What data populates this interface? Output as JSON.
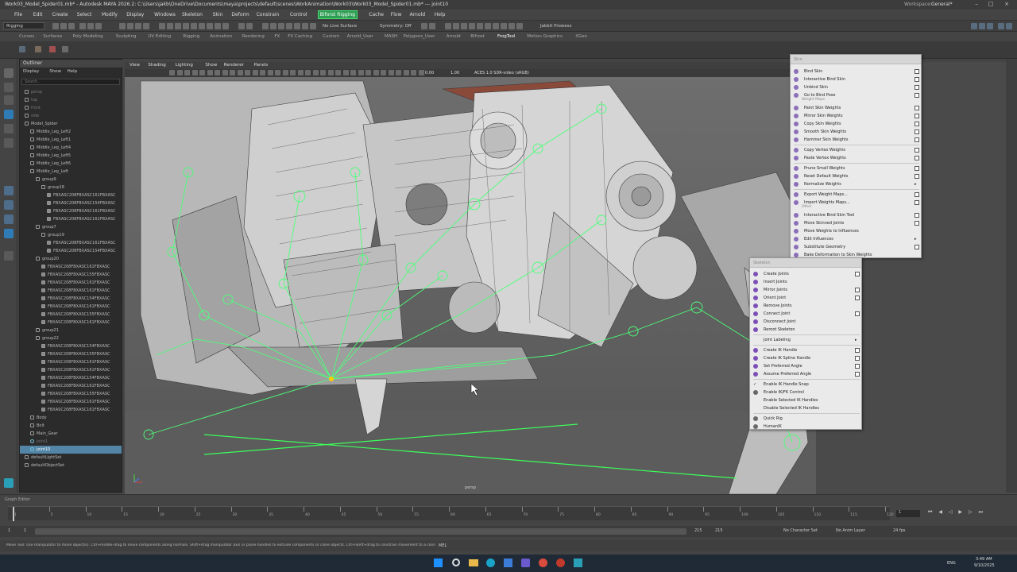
{
  "window": {
    "title": "Work03_Model_Spider01.mb* - Autodesk MAYA 2026.2: C:\\Users\\jakb\\OneDrive\\Documents\\maya\\projects\\default\\scenes\\WorkAnimation\\Work03\\Work03_Model_Spider01.mb* --- joint10",
    "workspace_label": "Workspace:",
    "workspace_value": "General*"
  },
  "menubar": [
    {
      "label": "File"
    },
    {
      "label": "Edit"
    },
    {
      "label": "Create"
    },
    {
      "label": "Select"
    },
    {
      "label": "Modify"
    },
    {
      "label": "Display"
    },
    {
      "label": "Windows"
    },
    {
      "label": "Skeleton"
    },
    {
      "label": "Skin"
    },
    {
      "label": "Deform"
    },
    {
      "label": "Constrain"
    },
    {
      "label": "Control"
    },
    {
      "label": "Biforst Rigging"
    },
    {
      "label": "Cache"
    },
    {
      "label": "Flow"
    },
    {
      "label": "Arnold"
    },
    {
      "label": "Help"
    }
  ],
  "status": {
    "menuset": "Rigging",
    "live_surface": "No Live Surface",
    "symmetry": "Symmetry: Off",
    "user": "Jakbit Prowess"
  },
  "shelf_tabs": [
    "Curves",
    "Surfaces",
    "Poly Modeling",
    "Sculpting",
    "UV Editing",
    "Rigging",
    "Animation",
    "Rendering",
    "FX",
    "FX Caching",
    "Custom",
    "Arnold_User",
    "MASH",
    "Polygons_User",
    "Arnold",
    "Bifrost",
    "FrogTool",
    "Motion Graphics",
    "XGen"
  ],
  "active_shelf": "FrogTool",
  "outliner": {
    "title": "Outliner",
    "menu": [
      "Display",
      "Show",
      "Help"
    ],
    "search_placeholder": "Search...",
    "rows": [
      {
        "label": "persp",
        "indent": 0,
        "kind": "cam",
        "dim": true
      },
      {
        "label": "top",
        "indent": 0,
        "kind": "cam",
        "dim": true
      },
      {
        "label": "front",
        "indent": 0,
        "kind": "cam",
        "dim": true
      },
      {
        "label": "side",
        "indent": 0,
        "kind": "cam",
        "dim": true
      },
      {
        "label": "Model_Spider",
        "indent": 0,
        "kind": "group"
      },
      {
        "label": "Middle_Leg_Left2",
        "indent": 1,
        "kind": "group"
      },
      {
        "label": "Middle_Leg_Left1",
        "indent": 1,
        "kind": "group"
      },
      {
        "label": "Middle_Leg_Left4",
        "indent": 1,
        "kind": "group"
      },
      {
        "label": "Middle_Leg_Left5",
        "indent": 1,
        "kind": "group"
      },
      {
        "label": "Middle_Leg_Left6",
        "indent": 1,
        "kind": "group"
      },
      {
        "label": "Middle_Leg_Left",
        "indent": 1,
        "kind": "group"
      },
      {
        "label": "group9",
        "indent": 2,
        "kind": "group"
      },
      {
        "label": "group18",
        "indent": 3,
        "kind": "group"
      },
      {
        "label": "FBXASC208FBXASC161FBXASC",
        "indent": 4,
        "kind": "mesh"
      },
      {
        "label": "FBXASC208FBXASC154FBXASC",
        "indent": 4,
        "kind": "mesh"
      },
      {
        "label": "FBXASC208FBXASC161FBXASC",
        "indent": 4,
        "kind": "mesh"
      },
      {
        "label": "FBXASC208FBXASC161FBXASC",
        "indent": 4,
        "kind": "mesh"
      },
      {
        "label": "group7",
        "indent": 2,
        "kind": "group"
      },
      {
        "label": "group19",
        "indent": 3,
        "kind": "group"
      },
      {
        "label": "FBXASC208FBXASC161FBXASC",
        "indent": 4,
        "kind": "mesh"
      },
      {
        "label": "FBXASC208FBXASC154FBXASC",
        "indent": 4,
        "kind": "mesh"
      },
      {
        "label": "group20",
        "indent": 2,
        "kind": "group"
      },
      {
        "label": "FBXASC208FBXASC161FBXASC",
        "indent": 3,
        "kind": "mesh"
      },
      {
        "label": "FBXASC208FBXASC155FBXASC",
        "indent": 3,
        "kind": "mesh"
      },
      {
        "label": "FBXASC208FBXASC161FBXASC",
        "indent": 3,
        "kind": "mesh"
      },
      {
        "label": "FBXASC208FBXASC161FBXASC",
        "indent": 3,
        "kind": "mesh"
      },
      {
        "label": "FBXASC208FBXASC154FBXASC",
        "indent": 3,
        "kind": "mesh"
      },
      {
        "label": "FBXASC208FBXASC161FBXASC",
        "indent": 3,
        "kind": "mesh"
      },
      {
        "label": "FBXASC208FBXASC155FBXASC",
        "indent": 3,
        "kind": "mesh"
      },
      {
        "label": "FBXASC208FBXASC161FBXASC",
        "indent": 3,
        "kind": "mesh"
      },
      {
        "label": "group21",
        "indent": 2,
        "kind": "group"
      },
      {
        "label": "group22",
        "indent": 2,
        "kind": "group"
      },
      {
        "label": "FBXASC208FBXASC154FBXASC",
        "indent": 3,
        "kind": "mesh"
      },
      {
        "label": "FBXASC208FBXASC155FBXASC",
        "indent": 3,
        "kind": "mesh"
      },
      {
        "label": "FBXASC208FBXASC161FBXASC",
        "indent": 3,
        "kind": "mesh"
      },
      {
        "label": "FBXASC208FBXASC161FBXASC",
        "indent": 3,
        "kind": "mesh"
      },
      {
        "label": "FBXASC208FBXASC154FBXASC",
        "indent": 3,
        "kind": "mesh"
      },
      {
        "label": "FBXASC208FBXASC161FBXASC",
        "indent": 3,
        "kind": "mesh"
      },
      {
        "label": "FBXASC208FBXASC155FBXASC",
        "indent": 3,
        "kind": "mesh"
      },
      {
        "label": "FBXASC208FBXASC161FBXASC",
        "indent": 3,
        "kind": "mesh"
      },
      {
        "label": "FBXASC208FBXASC161FBXASC",
        "indent": 3,
        "kind": "mesh"
      },
      {
        "label": "Body",
        "indent": 1,
        "kind": "group"
      },
      {
        "label": "Bolt",
        "indent": 1,
        "kind": "group"
      },
      {
        "label": "Main_Gear",
        "indent": 1,
        "kind": "group"
      },
      {
        "label": "joint1",
        "indent": 1,
        "kind": "joint",
        "dim": true
      },
      {
        "label": "joint10",
        "indent": 1,
        "kind": "joint",
        "selected": true
      },
      {
        "label": "defaultLightSet",
        "indent": 0,
        "kind": "set"
      },
      {
        "label": "defaultObjectSet",
        "indent": 0,
        "kind": "set"
      }
    ]
  },
  "viewport": {
    "menu": [
      "View",
      "Shading",
      "Lighting",
      "Show",
      "Renderer",
      "Panels"
    ],
    "exposure": "0.00",
    "gamma": "1.00",
    "color_space": "ACES 1.0 SDR-video (sRGB)",
    "camera_label": "persp"
  },
  "skin_menu": {
    "title": "Skin",
    "sections": [
      {
        "header": "",
        "items": [
          {
            "label": "Bind Skin",
            "box": true
          },
          {
            "label": "Interactive Bind Skin",
            "box": true
          },
          {
            "label": "Unbind Skin",
            "box": true
          },
          {
            "label": "Go to Bind Pose",
            "box": true
          }
        ]
      },
      {
        "header": "Weight Maps",
        "items": [
          {
            "label": "Paint Skin Weights",
            "box": true
          },
          {
            "label": "Mirror Skin Weights",
            "box": true
          },
          {
            "label": "Copy Skin Weights",
            "box": true
          },
          {
            "label": "Smooth Skin Weights",
            "box": true
          },
          {
            "label": "Hammer Skin Weights",
            "box": true
          }
        ]
      },
      {
        "header": "",
        "items": [
          {
            "label": "Copy Vertex Weights",
            "box": true
          },
          {
            "label": "Paste Vertex Weights",
            "box": true
          }
        ]
      },
      {
        "header": "",
        "items": [
          {
            "label": "Prune Small Weights",
            "box": true
          },
          {
            "label": "Reset Default Weights",
            "box": true
          },
          {
            "label": "Normalize Weights",
            "arrow": true
          }
        ]
      },
      {
        "header": "",
        "items": [
          {
            "label": "Export Weight Maps...",
            "box": true
          },
          {
            "label": "Import Weights Maps...",
            "box": true
          }
        ]
      },
      {
        "header": "Other",
        "items": [
          {
            "label": "Interactive Bind Skin Tool",
            "box": true
          },
          {
            "label": "Move Skinned Joints",
            "box": true
          },
          {
            "label": "Move Weights to Influences",
            "box": false
          },
          {
            "label": "Edit Influences",
            "arrow": true
          },
          {
            "label": "Substitute Geometry",
            "box": true
          },
          {
            "label": "Bake Deformation to Skin Weights",
            "box": false
          }
        ]
      }
    ]
  },
  "skeleton_menu": {
    "title": "Skeleton",
    "items": [
      {
        "label": "Create Joints",
        "box": true,
        "color": "#7c4fb8"
      },
      {
        "label": "Insert Joints",
        "box": false,
        "color": "#7c4fb8"
      },
      {
        "label": "Mirror Joints",
        "box": true,
        "color": "#7c4fb8"
      },
      {
        "label": "Orient Joint",
        "box": true,
        "color": "#7c4fb8"
      },
      {
        "label": "Remove Joints",
        "box": false,
        "color": "#7c4fb8"
      },
      {
        "label": "Connect Joint",
        "box": true,
        "color": "#7c4fb8"
      },
      {
        "label": "Disconnect Joint",
        "box": false,
        "color": "#7c4fb8"
      },
      {
        "label": "Reroot Skeleton",
        "box": false,
        "color": "#7c4fb8"
      },
      {
        "label": "Joint Labeling",
        "arrow": true,
        "color": ""
      },
      {
        "label": "Create IK Handle",
        "box": true,
        "color": "#7c4fb8"
      },
      {
        "label": "Create IK Spline Handle",
        "box": true,
        "color": "#7c4fb8"
      },
      {
        "label": "Set Preferred Angle",
        "box": true,
        "color": "#7c4fb8"
      },
      {
        "label": "Assume Preferred Angle",
        "box": true,
        "color": "#7c4fb8"
      },
      {
        "label": "Enable IK Handle Snap",
        "box": false,
        "check": true,
        "color": ""
      },
      {
        "label": "Enable IK/FK Control",
        "box": false,
        "color": "#666666"
      },
      {
        "label": "Enable Selected IK Handles",
        "box": false,
        "color": ""
      },
      {
        "label": "Disable Selected IK Handles",
        "box": false,
        "color": ""
      },
      {
        "label": "Quick Rig",
        "box": false,
        "color": "#6a6a6a"
      },
      {
        "label": "HumanIK",
        "box": false,
        "color": "#6a6a6a"
      }
    ]
  },
  "timeline": {
    "ticks": [
      "1",
      "5",
      "10",
      "15",
      "20",
      "25",
      "30",
      "35",
      "40",
      "45",
      "50",
      "55",
      "60",
      "65",
      "70",
      "75",
      "80",
      "85",
      "90",
      "95",
      "100",
      "105",
      "110",
      "115",
      "120"
    ],
    "current_frame": "1",
    "range_start": "1",
    "range_inner_start": "1",
    "range_inner_end": "215",
    "range_end": "215",
    "character_set": "No Character Set",
    "anim_layer": "No Anim Layer",
    "fps": "24 fps",
    "graph_editor_label": "Graph Editor"
  },
  "helpline": {
    "text": "Move Tool: Use manipulator to move object(s). Ctrl+middle-drag to move components along normals. Shift+drag manipulator axis or plane handles to extrude components or clone objects. Ctrl+Shift+drag to constrain movement to a connected edge.",
    "mel": "MEL"
  },
  "taskbar": {
    "lang": "ENG",
    "time": "3:49 AM",
    "date": "9/10/2025"
  },
  "colors": {
    "accent_green": "#2c9e53",
    "selection_blue": "#5285a6",
    "wire_green": "#4dff7a"
  }
}
